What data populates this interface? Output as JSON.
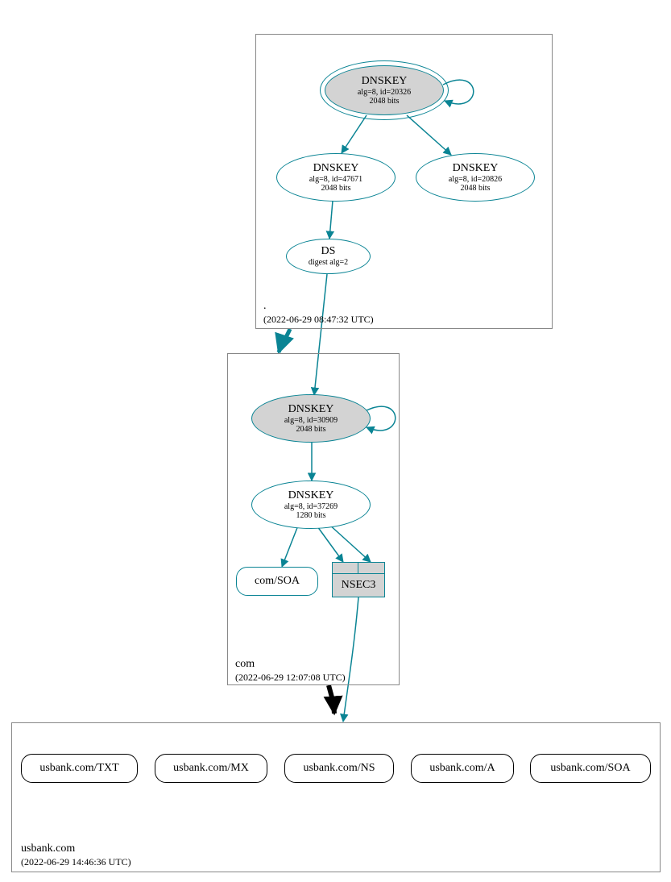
{
  "colors": {
    "teal": "#0a8494",
    "gray_fill": "#d3d3d3",
    "black": "#000000",
    "box_border": "#888888"
  },
  "zones": {
    "root": {
      "name": ".",
      "timestamp": "(2022-06-29 08:47:32 UTC)"
    },
    "com": {
      "name": "com",
      "timestamp": "(2022-06-29 12:07:08 UTC)"
    },
    "usbank": {
      "name": "usbank.com",
      "timestamp": "(2022-06-29 14:46:36 UTC)"
    }
  },
  "nodes": {
    "root_ksk": {
      "title": "DNSKEY",
      "line1": "alg=8, id=20326",
      "line2": "2048 bits"
    },
    "root_zsk": {
      "title": "DNSKEY",
      "line1": "alg=8, id=47671",
      "line2": "2048 bits"
    },
    "root_key3": {
      "title": "DNSKEY",
      "line1": "alg=8, id=20826",
      "line2": "2048 bits"
    },
    "root_ds": {
      "title": "DS",
      "line1": "digest alg=2"
    },
    "com_ksk": {
      "title": "DNSKEY",
      "line1": "alg=8, id=30909",
      "line2": "2048 bits"
    },
    "com_zsk": {
      "title": "DNSKEY",
      "line1": "alg=8, id=37269",
      "line2": "1280 bits"
    },
    "com_soa": {
      "label": "com/SOA"
    },
    "nsec3": {
      "label": "NSEC3"
    },
    "rr_txt": {
      "label": "usbank.com/TXT"
    },
    "rr_mx": {
      "label": "usbank.com/MX"
    },
    "rr_ns": {
      "label": "usbank.com/NS"
    },
    "rr_a": {
      "label": "usbank.com/A"
    },
    "rr_soa": {
      "label": "usbank.com/SOA"
    }
  }
}
